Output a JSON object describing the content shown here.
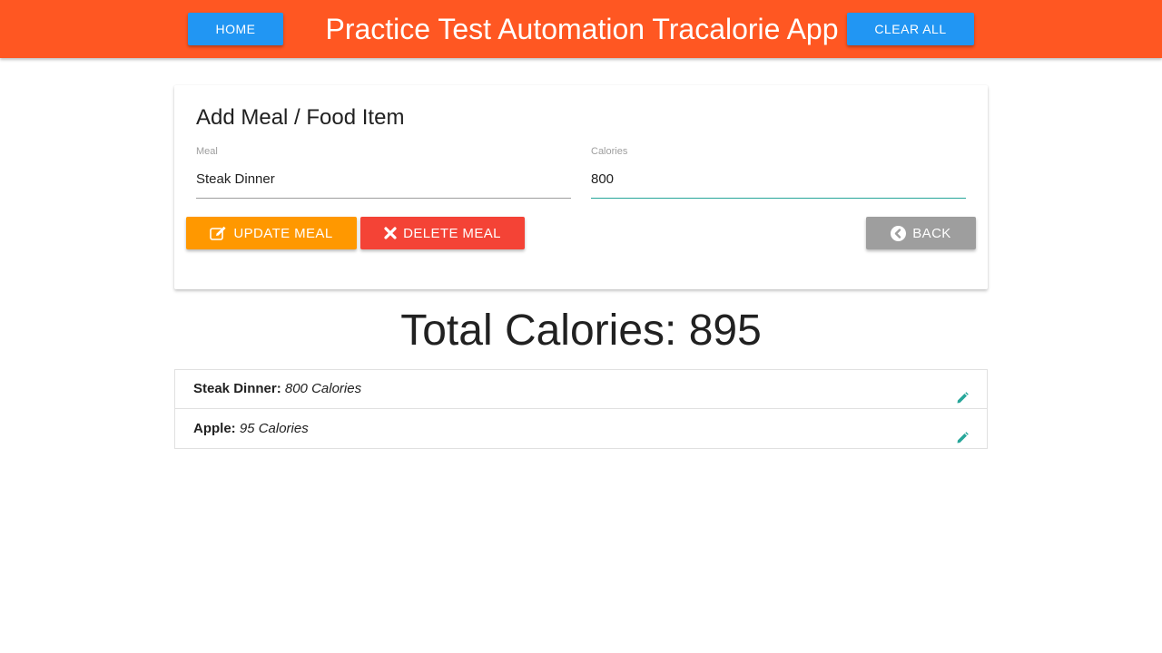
{
  "header": {
    "home_label": "HOME",
    "title": "Practice Test Automation Tracalorie App",
    "clear_all_label": "CLEAR ALL"
  },
  "form": {
    "title": "Add Meal / Food Item",
    "meal_label": "Meal",
    "meal_value": "Steak Dinner",
    "calories_label": "Calories",
    "calories_value": "800",
    "update_label": "UPDATE MEAL",
    "delete_label": "DELETE MEAL",
    "back_label": "BACK"
  },
  "total": {
    "label": "Total Calories:",
    "value": "895"
  },
  "items": [
    {
      "name": "Steak Dinner:",
      "calories": "800 Calories"
    },
    {
      "name": "Apple:",
      "calories": "95 Calories"
    }
  ],
  "icons": {
    "update": "edit-icon",
    "delete": "close-icon",
    "back": "chevron-circle-left-icon",
    "item_edit": "pencil-icon"
  },
  "colors": {
    "navbar": "#ff5722",
    "nav_button": "#2196f3",
    "update_button": "#ff9800",
    "delete_button": "#f44336",
    "back_button": "#9e9e9e",
    "accent": "#26a69a"
  }
}
